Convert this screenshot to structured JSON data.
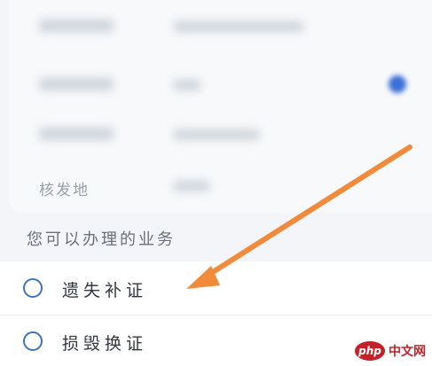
{
  "card": {
    "issuer_label": "核发地"
  },
  "section": {
    "title": "您可以办理的业务"
  },
  "options": [
    {
      "label": "遗失补证",
      "selected": false
    },
    {
      "label": "损毁换证",
      "selected": false
    }
  ],
  "annotation": {
    "arrow_color": "#f28a3b"
  },
  "watermark": {
    "brand_text": "php",
    "site_text": "中文网"
  },
  "colors": {
    "radio_border": "#3c72c4",
    "background": "#f3f5f8",
    "watermark_red": "#c2232b"
  }
}
